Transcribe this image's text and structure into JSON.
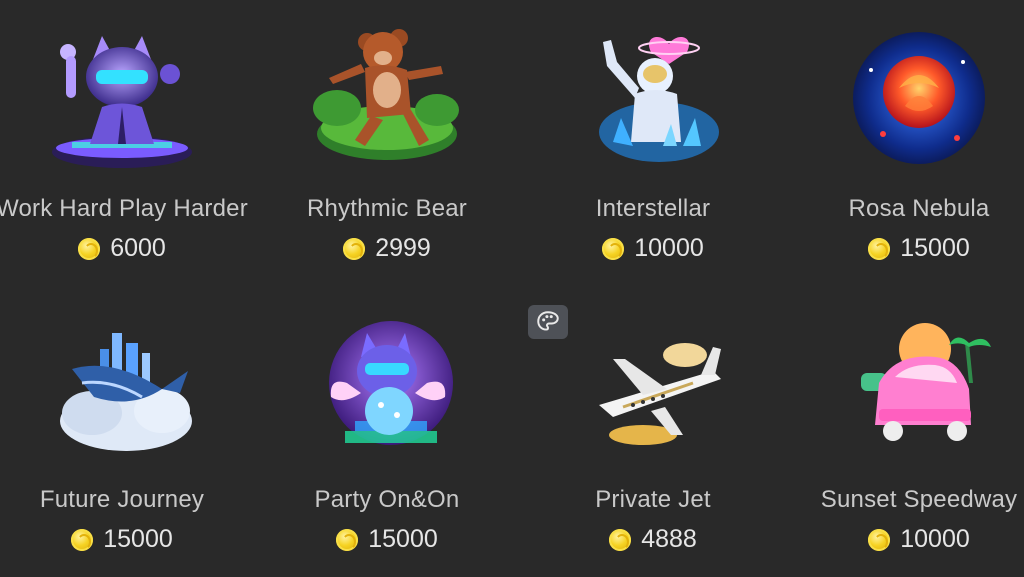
{
  "gifts": [
    {
      "name": "Work Hard Play Harder",
      "price": "6000",
      "icon": "cat-dj-icon"
    },
    {
      "name": "Rhythmic Bear",
      "price": "2999",
      "icon": "bear-icon"
    },
    {
      "name": "Interstellar",
      "price": "10000",
      "icon": "astronaut-icon"
    },
    {
      "name": "Rosa Nebula",
      "price": "15000",
      "icon": "rose-nebula-icon"
    },
    {
      "name": "Future Journey",
      "price": "15000",
      "icon": "whale-city-icon"
    },
    {
      "name": "Party On&On",
      "price": "15000",
      "icon": "party-cat-icon"
    },
    {
      "name": "Private Jet",
      "price": "4888",
      "icon": "jet-icon"
    },
    {
      "name": "Sunset Speedway",
      "price": "10000",
      "icon": "pink-car-icon"
    }
  ],
  "coin_color": "#f6d323",
  "background": "#292929",
  "palette_icon": "palette-icon"
}
